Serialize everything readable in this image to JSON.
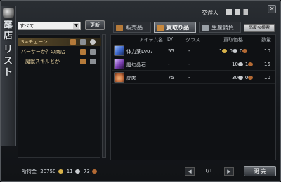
{
  "window": {
    "title": "交渉人",
    "side_tab": [
      "露",
      "店",
      "リ",
      "ス",
      "ト"
    ],
    "close_glyph": "×"
  },
  "left": {
    "filter_value": "すべて",
    "update_label": "更新",
    "shops": [
      {
        "name": "S≈チェーン",
        "selected": true
      },
      {
        "name": "バーサーか？の商店",
        "selected": false
      },
      {
        "name": "魔獣スキルとか",
        "selected": false
      }
    ]
  },
  "gold": {
    "label": "所持金",
    "gold": "20750",
    "silver": "11",
    "copper": "73"
  },
  "tabs": [
    {
      "label": "販売品",
      "active": false
    },
    {
      "label": "買取り品",
      "active": true
    },
    {
      "label": "生産請負",
      "active": false
    }
  ],
  "advanced_search_label": "高度な検索",
  "table": {
    "headers": {
      "item": "アイテム名",
      "lv": "LV",
      "class": "クラス",
      "price": "買取価格",
      "qty": "数量"
    },
    "rows": [
      {
        "name": "体力薬Lv07",
        "lv": "55",
        "class": "-",
        "gold": "1",
        "silver": "0",
        "copper": "0",
        "qty": "10",
        "icon_color": "#3b64c8"
      },
      {
        "name": "魔幻晶石",
        "lv": "-",
        "class": "-",
        "gold": "",
        "silver": "10",
        "copper": "1",
        "qty": "15",
        "icon_color": "#7a3fb0"
      },
      {
        "name": "虎肉",
        "lv": "75",
        "class": "-",
        "gold": "",
        "silver": "30",
        "copper": "0",
        "qty": "10",
        "icon_color": "#c06a3a"
      }
    ]
  },
  "pager": {
    "text": "1/1",
    "prev": "◀",
    "next": "▶"
  },
  "close_label": "閉 完"
}
